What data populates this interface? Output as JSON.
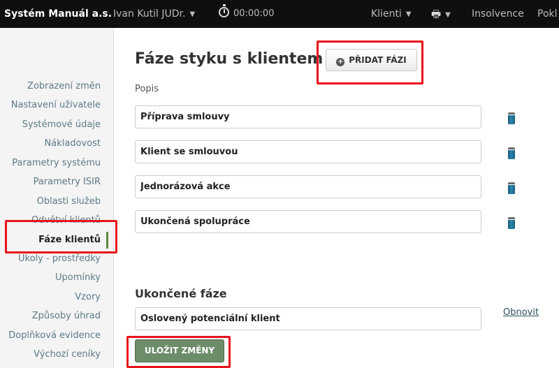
{
  "topbar": {
    "brand": "Systém Manuál a.s.",
    "user": "Ivan Kutil JUDr.",
    "timer": "00:00:00",
    "nav": {
      "clients": "Klienti",
      "insolvence": "Insolvence",
      "pokl": "Pokl"
    },
    "icons": {
      "dropdown": "chevron-down-icon",
      "timer": "stopwatch-icon",
      "printer": "printer-icon"
    }
  },
  "sidebar": {
    "items": [
      {
        "label": "Zobrazení změn"
      },
      {
        "label": "Nastavení uživatele"
      },
      {
        "label": "Systémové údaje"
      },
      {
        "label": "Nákladovost"
      },
      {
        "label": "Parametry systému"
      },
      {
        "label": "Parametry ISIR"
      },
      {
        "label": "Oblasti služeb"
      },
      {
        "label": "Odvětví klientů"
      },
      {
        "label": "Fáze klientů",
        "active": true
      },
      {
        "label": "Úkoly - prostředky"
      },
      {
        "label": "Upomínky"
      },
      {
        "label": "Vzory"
      },
      {
        "label": "Způsoby úhrad"
      },
      {
        "label": "Doplňková evidence"
      },
      {
        "label": "Výchozí ceníky"
      }
    ]
  },
  "main": {
    "title": "Fáze styku s klientem",
    "add_button": "PŘIDAT FÁZI",
    "popis_label": "Popis",
    "phases": [
      {
        "value": "Příprava smlouvy"
      },
      {
        "value": "Klient se smlouvou"
      },
      {
        "value": "Jednorázová akce"
      },
      {
        "value": "Ukončená spolupráce"
      }
    ],
    "ended_heading": "Ukončené fáze",
    "ended_phase": "Oslovený potenciální klient",
    "refresh_link": "Obnovit",
    "save_button": "ULOŽIT ZMĚNY"
  },
  "colors": {
    "topbar": "#0f0f0f",
    "accent_green": "#6d8d6a",
    "highlight_red": "#e8141b",
    "link": "#5d7a86"
  }
}
